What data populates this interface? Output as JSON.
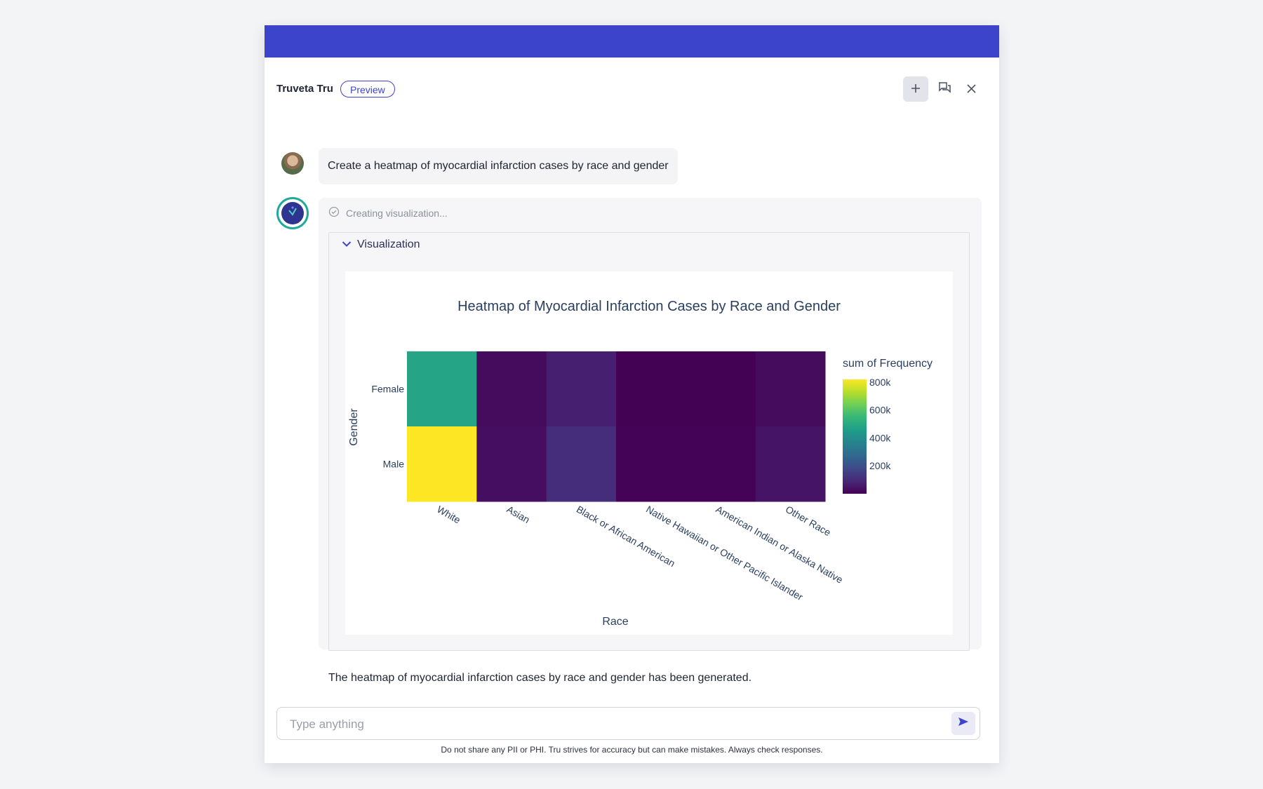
{
  "header": {
    "title": "Truveta Tru",
    "badge": "Preview",
    "icons": {
      "new_chat": "plus-icon",
      "history": "chat-history-icon",
      "close": "close-icon"
    }
  },
  "conversation": {
    "user_message": "Create a heatmap of myocardial infarction cases by race and gender",
    "status_text": "Creating visualization...",
    "visualization_label": "Visualization",
    "result_text": "The heatmap of myocardial infarction cases by race and gender has been generated."
  },
  "chart_data": {
    "type": "heatmap",
    "title": "Heatmap of Myocardial Infarction Cases by Race and Gender",
    "xlabel": "Race",
    "ylabel": "Gender",
    "x": [
      "White",
      "Asian",
      "Black or African American",
      "Native Hawaiian or Other Pacific Islander",
      "American Indian or Alaska Native",
      "Other Race"
    ],
    "y": [
      "Female",
      "Male"
    ],
    "z": [
      [
        480000,
        25000,
        70000,
        3000,
        3000,
        25000
      ],
      [
        820000,
        30000,
        105000,
        4000,
        4000,
        45000
      ]
    ],
    "colorscale": "Viridis",
    "zlim": [
      0,
      820000
    ],
    "colorbar": {
      "title": "sum of Frequency",
      "tickvals": [
        200000,
        400000,
        600000,
        800000
      ],
      "ticktext": [
        "200k",
        "400k",
        "600k",
        "800k"
      ]
    }
  },
  "input": {
    "placeholder": "Type anything",
    "value": ""
  },
  "footer": {
    "disclaimer": "Do not share any PII or PHI. Tru strives for accuracy but can make mistakes. Always check responses."
  },
  "colors": {
    "accent": "#3d44cc",
    "bot_ring": "#22a99a"
  }
}
